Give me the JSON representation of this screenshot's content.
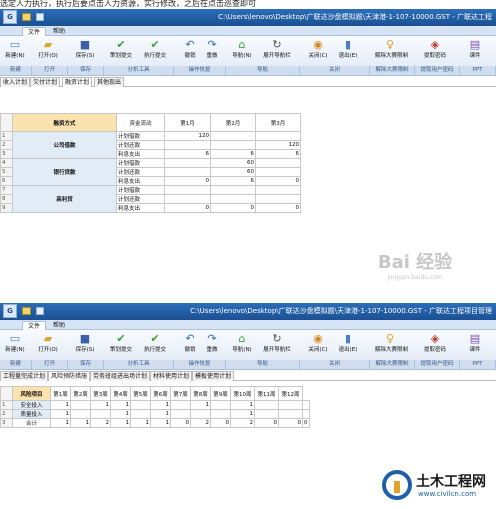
{
  "caption": "选定人力执行，执行后要点击人力资源，实行修改，之后在点击巡查即可",
  "title_path": "C:\\Users\\lenovo\\Desktop\\广联达沙盘模拟题\\天津港-1-107-10000.GST - 广联达工程",
  "title_path_2": "C:\\Users\\lenovo\\Desktop\\广联达沙盘模拟题\\天津港-1-107-10000.GST - 广联达工程项目管理",
  "menu_tabs": [
    "文件",
    "帮助"
  ],
  "ribbon_buttons": [
    {
      "label": "新建(N)",
      "icon": "new-file-icon"
    },
    {
      "label": "打开(O)",
      "icon": "open-folder-icon"
    },
    {
      "label": "保存(S)",
      "icon": "save-icon"
    },
    {
      "label": "策划提交",
      "icon": "check-icon"
    },
    {
      "label": "执行提交",
      "icon": "check-icon"
    },
    {
      "label": "撤销",
      "icon": "undo-icon"
    },
    {
      "label": "重做",
      "icon": "redo-icon"
    },
    {
      "label": "导航(N)",
      "icon": "home-icon"
    },
    {
      "label": "展开导航栏",
      "icon": "refresh-icon"
    },
    {
      "label": "关闭(C)",
      "icon": "close-icon"
    },
    {
      "label": "退出(E)",
      "icon": "exit-icon"
    },
    {
      "label": "解除大赛限制",
      "icon": "key-icon"
    },
    {
      "label": "提取密码",
      "icon": "password-icon"
    },
    {
      "label": "课件",
      "icon": "courseware-icon"
    }
  ],
  "ribbon_groups": [
    "新建",
    "打开",
    "保存",
    "分析工具",
    "操作恢复",
    "导航",
    "关闭",
    "解除大赛限制",
    "提取用户密码",
    "PPT"
  ],
  "top": {
    "sheet_tabs": [
      "收入计划",
      "欠付计划",
      "融资计划",
      "其他现出"
    ],
    "active_tab": "融资计划",
    "headers": [
      "融资方式",
      "资金流动",
      "第1月",
      "第2月",
      "第3月"
    ],
    "rows": [
      {
        "rn": "1",
        "type": "公司借款",
        "flow": "计划借款",
        "m1": "120",
        "m2": "",
        "m3": ""
      },
      {
        "rn": "2",
        "type": "",
        "flow": "计划还款",
        "m1": "",
        "m2": "",
        "m3": "120"
      },
      {
        "rn": "3",
        "type": "",
        "flow": "利息支出",
        "m1": "6",
        "m2": "6",
        "m3": "6"
      },
      {
        "rn": "4",
        "type": "银行贷款",
        "flow": "计划借款",
        "m1": "",
        "m2": "60",
        "m3": ""
      },
      {
        "rn": "5",
        "type": "",
        "flow": "计划还款",
        "m1": "",
        "m2": "60",
        "m3": ""
      },
      {
        "rn": "6",
        "type": "",
        "flow": "利息支出",
        "m1": "0",
        "m2": "6",
        "m3": "0"
      },
      {
        "rn": "7",
        "type": "高利贷",
        "flow": "计划借款",
        "m1": "",
        "m2": "",
        "m3": ""
      },
      {
        "rn": "8",
        "type": "",
        "flow": "计划还款",
        "m1": "",
        "m2": "",
        "m3": ""
      },
      {
        "rn": "9",
        "type": "",
        "flow": "利息支出",
        "m1": "0",
        "m2": "0",
        "m3": "0"
      }
    ]
  },
  "watermark": {
    "text": "Bai 经验",
    "sub": "jingyan.baidu.com"
  },
  "bottom": {
    "sheet_tabs": [
      "工程量完成计划",
      "风险预防措施",
      "劳务班组进出场计划",
      "材料使用计划",
      "模板使用计划"
    ],
    "active_tab": "风险预防措施",
    "headers": [
      "风险项目",
      "第1周",
      "第2周",
      "第3周",
      "第4周",
      "第5周",
      "第6周",
      "第7周",
      "第8周",
      "第9周",
      "第10周",
      "第11周",
      "第12周"
    ],
    "rows": [
      {
        "rn": "1",
        "name": "安全投入",
        "w": [
          "1",
          "",
          "1",
          "1",
          "",
          "1",
          "",
          "1",
          "",
          "1",
          "",
          "",
          ""
        ]
      },
      {
        "rn": "2",
        "name": "质量投入",
        "w": [
          "1",
          "",
          "",
          "1",
          "",
          "1",
          "",
          "",
          "",
          "1",
          "",
          "",
          ""
        ]
      },
      {
        "rn": "3",
        "name": "合计",
        "w": [
          "1",
          "1",
          "2",
          "1",
          "1",
          "1",
          "0",
          "2",
          "0",
          "2",
          "0",
          "0",
          "0"
        ]
      }
    ]
  },
  "brand": {
    "name": "土木工程网",
    "url": "www.civilcn.com"
  }
}
